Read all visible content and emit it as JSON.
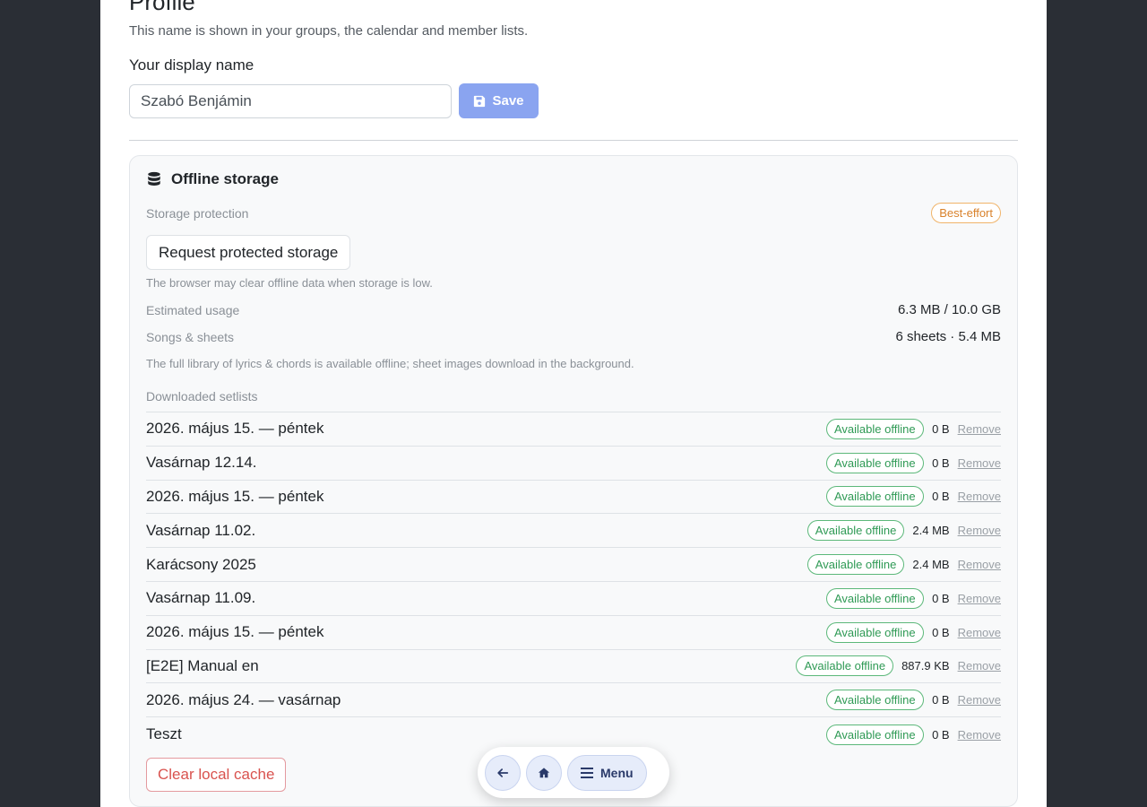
{
  "profile": {
    "title": "Profile",
    "subtitle": "This name is shown in your groups, the calendar and member lists.",
    "display_name_label": "Your display name",
    "display_name_value": "Szabó Benjámin",
    "save_label": "Save"
  },
  "storage": {
    "heading": "Offline storage",
    "protection_label": "Storage protection",
    "protection_badge": "Best-effort",
    "request_button": "Request protected storage",
    "clear_note": "The browser may clear offline data when storage is low.",
    "estimated_label": "Estimated usage",
    "estimated_value": "6.3 MB / 10.0 GB",
    "songs_label": "Songs & sheets",
    "songs_value": "6 sheets · 5.4 MB",
    "library_note": "The full library of lyrics & chords is available offline; sheet images download in the background.",
    "downloaded_label": "Downloaded setlists",
    "setlists": [
      {
        "name": "2026. május 15. — péntek",
        "status": "Available offline",
        "size": "0 B",
        "remove": "Remove"
      },
      {
        "name": "Vasárnap 12.14.",
        "status": "Available offline",
        "size": "0 B",
        "remove": "Remove"
      },
      {
        "name": "2026. május 15. — péntek",
        "status": "Available offline",
        "size": "0 B",
        "remove": "Remove"
      },
      {
        "name": "Vasárnap 11.02.",
        "status": "Available offline",
        "size": "2.4 MB",
        "remove": "Remove"
      },
      {
        "name": "Karácsony 2025",
        "status": "Available offline",
        "size": "2.4 MB",
        "remove": "Remove"
      },
      {
        "name": "Vasárnap 11.09.",
        "status": "Available offline",
        "size": "0 B",
        "remove": "Remove"
      },
      {
        "name": "2026. május 15. — péntek",
        "status": "Available offline",
        "size": "0 B",
        "remove": "Remove"
      },
      {
        "name": "[E2E] Manual en",
        "status": "Available offline",
        "size": "887.9 KB",
        "remove": "Remove"
      },
      {
        "name": "2026. május 24. — vasárnap",
        "status": "Available offline",
        "size": "0 B",
        "remove": "Remove"
      },
      {
        "name": "Teszt",
        "status": "Available offline",
        "size": "0 B",
        "remove": "Remove"
      }
    ],
    "clear_cache": "Clear local cache"
  },
  "floatbar": {
    "back_icon": "arrow-left-icon",
    "home_icon": "home-icon",
    "menu_label": "Menu"
  },
  "colors": {
    "accent": "#8aa4f0",
    "success": "#2f9a55",
    "warning": "#d9822b",
    "danger": "#d9534f",
    "backdrop": "#2a2e35"
  }
}
